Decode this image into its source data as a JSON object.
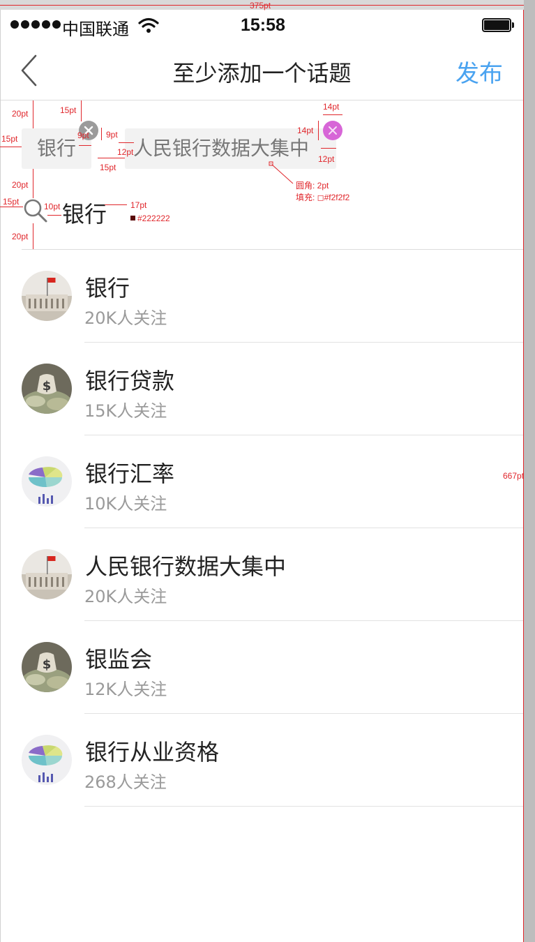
{
  "spec": {
    "width_label": "375pt",
    "height_label": "667pt",
    "gap_20": "20pt",
    "gap_15": "15pt",
    "gap_9": "9pt",
    "gap_12": "12pt",
    "gap_14": "14pt",
    "gap_10": "10pt",
    "font_17": "17pt",
    "color_222": "#222222",
    "radius_label": "圆角:  2pt",
    "fill_label": "填充:  ◻#f2f2f2"
  },
  "status_bar": {
    "carrier": "中国联通",
    "time": "15:58"
  },
  "nav": {
    "title": "至少添加一个话题",
    "publish": "发布",
    "back_icon": "chevron-left-icon"
  },
  "selected_tags": [
    {
      "label": "银行"
    },
    {
      "label": "人民银行数据大集中"
    }
  ],
  "search": {
    "value": "银行"
  },
  "topics": [
    {
      "name": "银行",
      "followers": "20K人关注",
      "avatar": "building-flag"
    },
    {
      "name": "银行贷款",
      "followers": "15K人关注",
      "avatar": "money-bag"
    },
    {
      "name": "银行汇率",
      "followers": "10K人关注",
      "avatar": "pie-chart"
    },
    {
      "name": "人民银行数据大集中",
      "followers": "20K人关注",
      "avatar": "building-flag"
    },
    {
      "name": "银监会",
      "followers": "12K人关注",
      "avatar": "money-bag"
    },
    {
      "name": "银行从业资格",
      "followers": "268人关注",
      "avatar": "pie-chart"
    }
  ],
  "colors": {
    "accent": "#4aa3f0",
    "text_primary": "#222222",
    "text_secondary": "#9a9a9a",
    "tag_fill": "#f2f2f2",
    "spec_red": "#e0262b",
    "tag_close_active": "#d766d7"
  }
}
